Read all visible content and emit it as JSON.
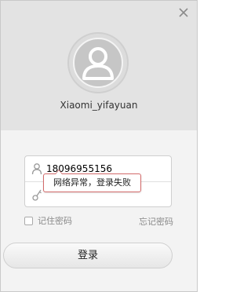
{
  "header": {
    "username": "Xiaomi_yifayuan",
    "close_icon": "close-icon",
    "avatar_icon": "default-avatar-icon"
  },
  "form": {
    "account_value": "18096955156",
    "account_icon": "user-icon",
    "password_value": "",
    "password_icon": "lock-icon",
    "error_tooltip": "网络异常，登录失败",
    "remember_label": "记住密码",
    "remember_checked": false,
    "forgot_label": "忘记密码",
    "login_label": "登录"
  },
  "colors": {
    "tooltip_border": "#d36a6a",
    "link_gray": "#8a8a8a"
  }
}
